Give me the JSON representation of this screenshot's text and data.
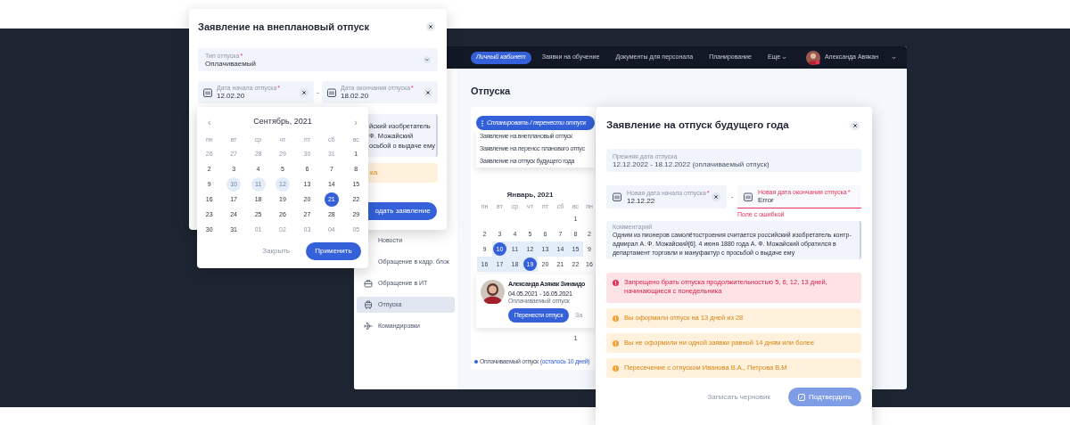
{
  "left_modal": {
    "title": "Заявление на внеплановый отпуск",
    "type_field": {
      "label": "Тип отпуска",
      "mark": "*",
      "value": "Оплачиваемый"
    },
    "start_field": {
      "label": "Дата начала отпуска",
      "mark": "*",
      "value": "12.02.20"
    },
    "separator": "-",
    "end_field": {
      "label": "Дата окончания отпуска",
      "mark": "*",
      "value": "18.02.20"
    },
    "comment_lines": [
      "йский изобретатель",
      "Ф. Можайский",
      "осьбой о выдаче ему"
    ],
    "alert_text": "ка",
    "submit_button": "одать заявление"
  },
  "date_picker": {
    "prev": "‹",
    "title": "Сентябрь, 2021",
    "next": "›",
    "weekdays": [
      "пн",
      "вт",
      "ср",
      "чт",
      "пт",
      "сб",
      "вс"
    ],
    "weeks": [
      [
        {
          "d": "26",
          "muted": true,
          "in_range": false,
          "selected": false
        },
        {
          "d": "27",
          "muted": true,
          "in_range": false,
          "selected": false
        },
        {
          "d": "28",
          "muted": true,
          "in_range": false,
          "selected": false
        },
        {
          "d": "29",
          "muted": true,
          "in_range": false,
          "selected": false
        },
        {
          "d": "30",
          "muted": true,
          "in_range": false,
          "selected": false
        },
        {
          "d": "31",
          "muted": true,
          "in_range": false,
          "selected": false
        },
        {
          "d": "1",
          "muted": false,
          "in_range": false,
          "selected": false
        }
      ],
      [
        {
          "d": "2",
          "muted": false,
          "in_range": false,
          "selected": false
        },
        {
          "d": "3",
          "muted": false,
          "in_range": false,
          "selected": false
        },
        {
          "d": "4",
          "muted": false,
          "in_range": false,
          "selected": false
        },
        {
          "d": "5",
          "muted": false,
          "in_range": false,
          "selected": false
        },
        {
          "d": "6",
          "muted": false,
          "in_range": false,
          "selected": false
        },
        {
          "d": "7",
          "muted": false,
          "in_range": false,
          "selected": false
        },
        {
          "d": "8",
          "muted": false,
          "in_range": false,
          "selected": false
        }
      ],
      [
        {
          "d": "9",
          "muted": false,
          "in_range": false,
          "selected": false
        },
        {
          "d": "10",
          "muted": false,
          "in_range": true,
          "selected": false
        },
        {
          "d": "11",
          "muted": false,
          "in_range": true,
          "selected": false
        },
        {
          "d": "12",
          "muted": false,
          "in_range": true,
          "selected": false
        },
        {
          "d": "13",
          "muted": false,
          "in_range": false,
          "selected": false
        },
        {
          "d": "14",
          "muted": false,
          "in_range": false,
          "selected": false
        },
        {
          "d": "15",
          "muted": false,
          "in_range": false,
          "selected": false
        }
      ],
      [
        {
          "d": "16",
          "muted": false,
          "in_range": false,
          "selected": false
        },
        {
          "d": "17",
          "muted": false,
          "in_range": false,
          "selected": false
        },
        {
          "d": "18",
          "muted": false,
          "in_range": false,
          "selected": false
        },
        {
          "d": "19",
          "muted": false,
          "in_range": false,
          "selected": false
        },
        {
          "d": "20",
          "muted": false,
          "in_range": false,
          "selected": false
        },
        {
          "d": "21",
          "muted": false,
          "in_range": false,
          "selected": true
        },
        {
          "d": "22",
          "muted": false,
          "in_range": false,
          "selected": false
        }
      ],
      [
        {
          "d": "23",
          "muted": false,
          "in_range": false,
          "selected": false
        },
        {
          "d": "24",
          "muted": false,
          "in_range": false,
          "selected": false
        },
        {
          "d": "25",
          "muted": false,
          "in_range": false,
          "selected": false
        },
        {
          "d": "26",
          "muted": false,
          "in_range": false,
          "selected": false
        },
        {
          "d": "27",
          "muted": false,
          "in_range": false,
          "selected": false
        },
        {
          "d": "28",
          "muted": false,
          "in_range": false,
          "selected": false
        },
        {
          "d": "29",
          "muted": false,
          "in_range": false,
          "selected": false
        }
      ],
      [
        {
          "d": "30",
          "muted": false,
          "in_range": false,
          "selected": false
        },
        {
          "d": "31",
          "muted": false,
          "in_range": false,
          "selected": false
        },
        {
          "d": "01",
          "muted": true,
          "in_range": false,
          "selected": false
        },
        {
          "d": "02",
          "muted": true,
          "in_range": false,
          "selected": false
        },
        {
          "d": "03",
          "muted": true,
          "in_range": false,
          "selected": false
        },
        {
          "d": "04",
          "muted": true,
          "in_range": false,
          "selected": false
        },
        {
          "d": "05",
          "muted": true,
          "in_range": false,
          "selected": false
        }
      ]
    ],
    "close_button": "Закрыть",
    "apply_button": "Применить"
  },
  "app": {
    "nav": [
      {
        "label": "Личный кабинет",
        "selected": true,
        "dropdown": false
      },
      {
        "label": "Заявки на обучение",
        "selected": false,
        "dropdown": false
      },
      {
        "label": "Документы для персонала",
        "selected": false,
        "dropdown": false
      },
      {
        "label": "Планирование",
        "selected": false,
        "dropdown": false
      },
      {
        "label": "Еще",
        "selected": false,
        "dropdown": true
      }
    ],
    "user": {
      "name": "Александа Авякан"
    },
    "sidebar": [
      {
        "label": "Новости",
        "kind": "plain",
        "selected": false
      },
      {
        "label": "Обращение в кадр. блок",
        "kind": "plain",
        "selected": false
      },
      {
        "label": "Обращение в ИТ",
        "kind": "briefcase",
        "selected": false
      },
      {
        "label": "Отпуска",
        "kind": "suitcase",
        "selected": true
      },
      {
        "label": "Командировки",
        "kind": "plane",
        "selected": false
      }
    ],
    "page_title": "Отпуска",
    "action_menu": {
      "button": "Спланировать / перенести отпуск",
      "items": [
        "Заявление на внеплановый отпуск",
        "Заявление на перенос планового отпус",
        "Заявление на отпуск будущего года"
      ]
    },
    "calendar": {
      "title": "Январь, 2021",
      "weekdays": [
        "пн",
        "вт",
        "ср",
        "чт",
        "пт",
        "сб",
        "вс"
      ],
      "weeks": [
        [
          {
            "d": "1",
            "in_range": false,
            "selected": false
          }
        ],
        [
          {
            "d": "2",
            "in_range": false,
            "selected": false
          },
          {
            "d": "3",
            "in_range": false,
            "selected": false
          },
          {
            "d": "4",
            "in_range": false,
            "selected": false
          },
          {
            "d": "5",
            "in_range": false,
            "selected": false
          },
          {
            "d": "6",
            "in_range": false,
            "selected": false
          },
          {
            "d": "7",
            "in_range": false,
            "selected": false
          },
          {
            "d": "8",
            "in_range": false,
            "selected": false
          }
        ],
        [
          {
            "d": "9",
            "in_range": false,
            "selected": false
          },
          {
            "d": "10",
            "in_range": true,
            "selected": true
          },
          {
            "d": "11",
            "in_range": true,
            "selected": false
          },
          {
            "d": "12",
            "in_range": true,
            "selected": false
          },
          {
            "d": "13",
            "in_range": true,
            "selected": false
          },
          {
            "d": "14",
            "in_range": true,
            "selected": false
          },
          {
            "d": "15",
            "in_range": true,
            "selected": false
          }
        ],
        [
          {
            "d": "16",
            "in_range": true,
            "selected": false
          },
          {
            "d": "17",
            "in_range": true,
            "selected": false
          },
          {
            "d": "18",
            "in_range": true,
            "selected": false
          },
          {
            "d": "19",
            "in_range": true,
            "selected": true
          },
          {
            "d": "20",
            "in_range": false,
            "selected": false
          },
          {
            "d": "21",
            "in_range": false,
            "selected": false
          },
          {
            "d": "22",
            "in_range": false,
            "selected": false
          }
        ]
      ],
      "next_month": {
        "weekday": "пн",
        "days": [
          "2",
          "9",
          "16"
        ]
      }
    },
    "person": {
      "name": "Александа Азякак Зинаидо",
      "dates": "04.05.2021 - 16.05.2021",
      "type": "Оплачиваемый отпуск",
      "button": "Перенести отпуск",
      "link": "За"
    },
    "lower_days": [
      "1"
    ],
    "legend": {
      "color": "#3461d9",
      "label": "Оплачиваемый отпуск",
      "note": "(осталось 10 дней)"
    }
  },
  "right_modal": {
    "title": "Заявление на отпуск будущего года",
    "previous": {
      "label": "Прежняя дата отпуска",
      "value": "12.12.2022 - 18.12.2022 (оплачиваемый отпуск)"
    },
    "start": {
      "label": "Новая дата начала отпуска",
      "mark": "*",
      "value": "12.12.22",
      "error": false
    },
    "separator": "-",
    "end": {
      "label": "Новая дата окончания отпуска",
      "mark": "*",
      "value": "Error",
      "error": true,
      "error_text": "Поле с ошибкой"
    },
    "comment": {
      "label": "Комментарий",
      "text": "Одним из пионеров самолётостроения считается российский изобретатель контр-адмирал А. Ф. Можайский[6]. 4 июня 1880 года А. Ф. Можайский обратился в департамент торговли и мануфактур с просьбой о выдаче ему"
    },
    "alerts": [
      {
        "kind": "error",
        "text": "Запрещено брать отпуска продолжительностью 5, 6, 12, 13 дней, начинающиеся с понедельника"
      },
      {
        "kind": "warning",
        "text": "Вы оформили отпуск на 13 дней из 28"
      },
      {
        "kind": "warning",
        "text": "Вы не оформили ни одной заявки равной 14 дням или более"
      },
      {
        "kind": "warning",
        "text": "Пересечение с отпуском Иванова В.А., Петрова В.М"
      }
    ],
    "draft_button": "Записать черновик",
    "confirm_button": {
      "label": "Подтвердить",
      "disabled": true
    }
  }
}
